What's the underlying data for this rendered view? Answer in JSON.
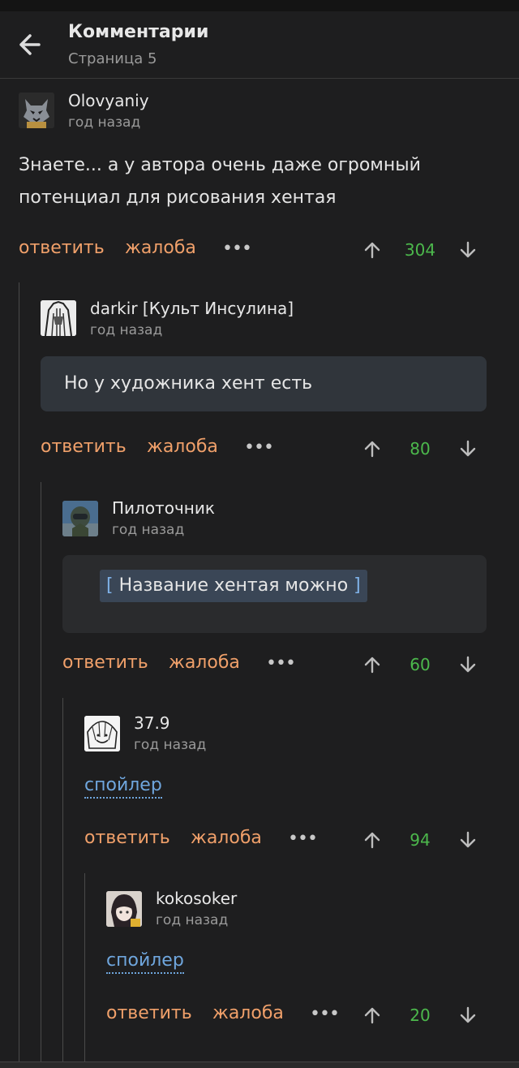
{
  "header": {
    "title": "Комментарии",
    "subtitle": "Страница 5"
  },
  "comments": [
    {
      "author": "Olovyaniy",
      "time": "год назад",
      "text": "Знаете... а у автора очень даже огромный потенциал для рисования хентая",
      "reply": "ответить",
      "report": "жалоба",
      "more": "•••",
      "score": "304"
    },
    {
      "author": "darkir [Культ Инсулина]",
      "time": "год назад",
      "quote": "Но у художника хент есть",
      "reply": "ответить",
      "report": "жалоба",
      "more": "•••",
      "score": "80"
    },
    {
      "author": "Пилоточник",
      "time": "год назад",
      "hidden_open": "[",
      "hidden_text": " Название хентая можно ",
      "hidden_close": "]",
      "reply": "ответить",
      "report": "жалоба",
      "more": "•••",
      "score": "60"
    },
    {
      "author": "37.9",
      "time": "год назад",
      "spoiler": "спойлер",
      "reply": "ответить",
      "report": "жалоба",
      "more": "•••",
      "score": "94"
    },
    {
      "author": "kokosoker",
      "time": "год назад",
      "spoiler": "спойлер",
      "reply": "ответить",
      "report": "жалоба",
      "more": "•••",
      "score": "20"
    }
  ],
  "colors": {
    "background": "#1e1e1f",
    "action": "#f0a06a",
    "score": "#4cb84c",
    "spoiler": "#6fa6dd"
  },
  "icons": {
    "back": "arrow-left-icon",
    "up": "arrow-up-icon",
    "down": "arrow-down-icon"
  }
}
